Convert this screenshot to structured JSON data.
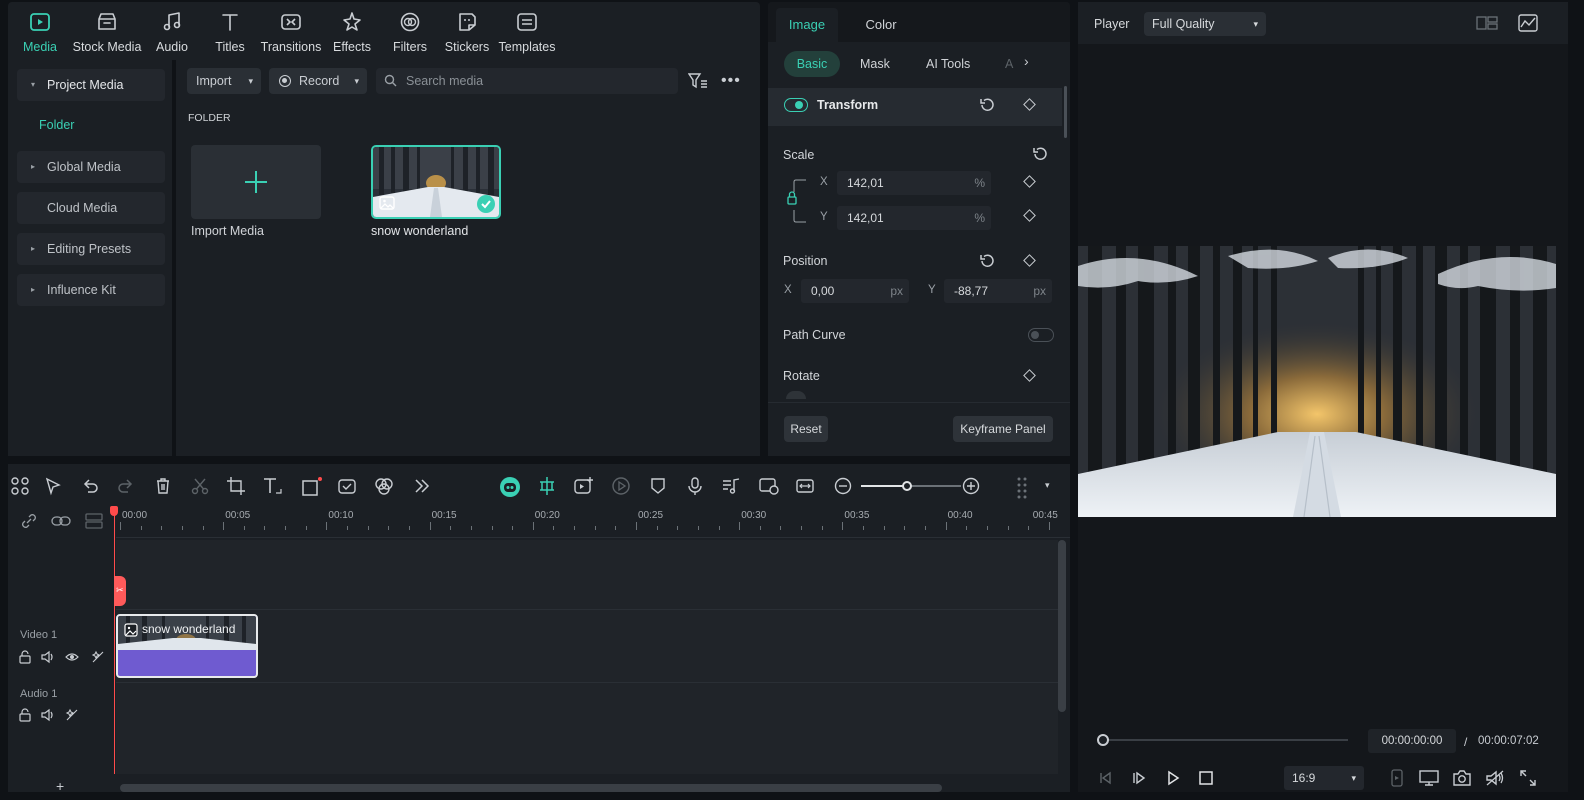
{
  "toolbar": {
    "items": [
      {
        "label": "Media",
        "icon": "media-icon",
        "active": true
      },
      {
        "label": "Stock Media",
        "icon": "stock-media-icon"
      },
      {
        "label": "Audio",
        "icon": "music-note-icon"
      },
      {
        "label": "Titles",
        "icon": "text-t-icon"
      },
      {
        "label": "Transitions",
        "icon": "transitions-icon"
      },
      {
        "label": "Effects",
        "icon": "effects-icon"
      },
      {
        "label": "Filters",
        "icon": "filters-icon"
      },
      {
        "label": "Stickers",
        "icon": "stickers-icon"
      },
      {
        "label": "Templates",
        "icon": "templates-icon"
      }
    ]
  },
  "leftnav": {
    "items": [
      {
        "label": "Project Media",
        "expandable": true,
        "open": true
      },
      {
        "label": "Global Media",
        "expandable": true
      },
      {
        "label": "Cloud Media",
        "expandable": false
      },
      {
        "label": "Editing Presets",
        "expandable": true
      },
      {
        "label": "Influence Kit",
        "expandable": true
      }
    ],
    "sub_item": "Folder"
  },
  "media": {
    "import_label": "Import",
    "record_label": "Record",
    "search_placeholder": "Search media",
    "folder_heading": "FOLDER",
    "tiles": [
      {
        "label": "Import Media"
      },
      {
        "label": "snow wonderland"
      }
    ]
  },
  "inspector": {
    "tabs": [
      "Image",
      "Color"
    ],
    "subtabs": [
      "Basic",
      "Mask",
      "AI Tools",
      "A"
    ],
    "transform_label": "Transform",
    "scale_label": "Scale",
    "scale_x_label": "X",
    "scale_y_label": "Y",
    "scale_x": "142,01",
    "scale_y": "142,01",
    "scale_unit": "%",
    "position_label": "Position",
    "pos_x_label": "X",
    "pos_y_label": "Y",
    "pos_x": "0,00",
    "pos_y": "-88,77",
    "pos_unit": "px",
    "path_curve_label": "Path Curve",
    "rotate_label": "Rotate",
    "reset_label": "Reset",
    "keyframe_panel_label": "Keyframe Panel"
  },
  "player": {
    "title": "Player",
    "quality": "Full Quality",
    "current_time": "00:00:00:00",
    "separator": "/",
    "total_time": "00:00:07:02",
    "aspect": "16:9"
  },
  "timeline": {
    "ruler_labels": [
      "00:00",
      "00:05",
      "00:10",
      "00:15",
      "00:20",
      "00:25",
      "00:30",
      "00:35",
      "00:40",
      "00:45"
    ],
    "video_track_label": "Video 1",
    "audio_track_label": "Audio 1",
    "clip_label": "snow wonderland",
    "add_track_label": "+"
  },
  "colors": {
    "accent": "#3ad0b4",
    "playhead": "#ff4b4b",
    "clip_purple": "#6f5bd0",
    "panel": "#1b1f24",
    "background": "#0f1216"
  }
}
